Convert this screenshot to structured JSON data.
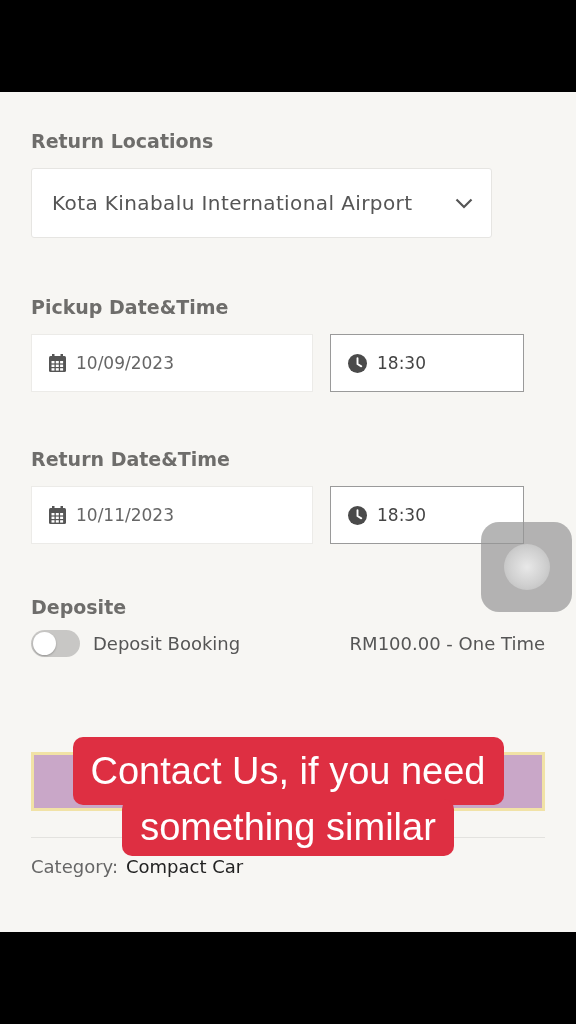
{
  "return_location": {
    "label": "Return Locations",
    "value": "Kota Kinabalu International Airport"
  },
  "pickup": {
    "label": "Pickup Date&Time",
    "fields": [
      {
        "kind": "date",
        "value": "10/09/2023"
      },
      {
        "kind": "time",
        "value": "18:30"
      }
    ]
  },
  "return": {
    "label": "Return Date&Time",
    "fields": [
      {
        "kind": "date",
        "value": "10/11/2023"
      },
      {
        "kind": "time",
        "value": "18:30"
      }
    ]
  },
  "deposit": {
    "label": "Deposite",
    "toggle_label": "Deposit Booking",
    "on": false,
    "price": "RM100.00 - One Time"
  },
  "category": {
    "label": "Category:",
    "value": "Compact Car"
  },
  "caption": [
    "Contact Us, if you need",
    "something similar"
  ]
}
